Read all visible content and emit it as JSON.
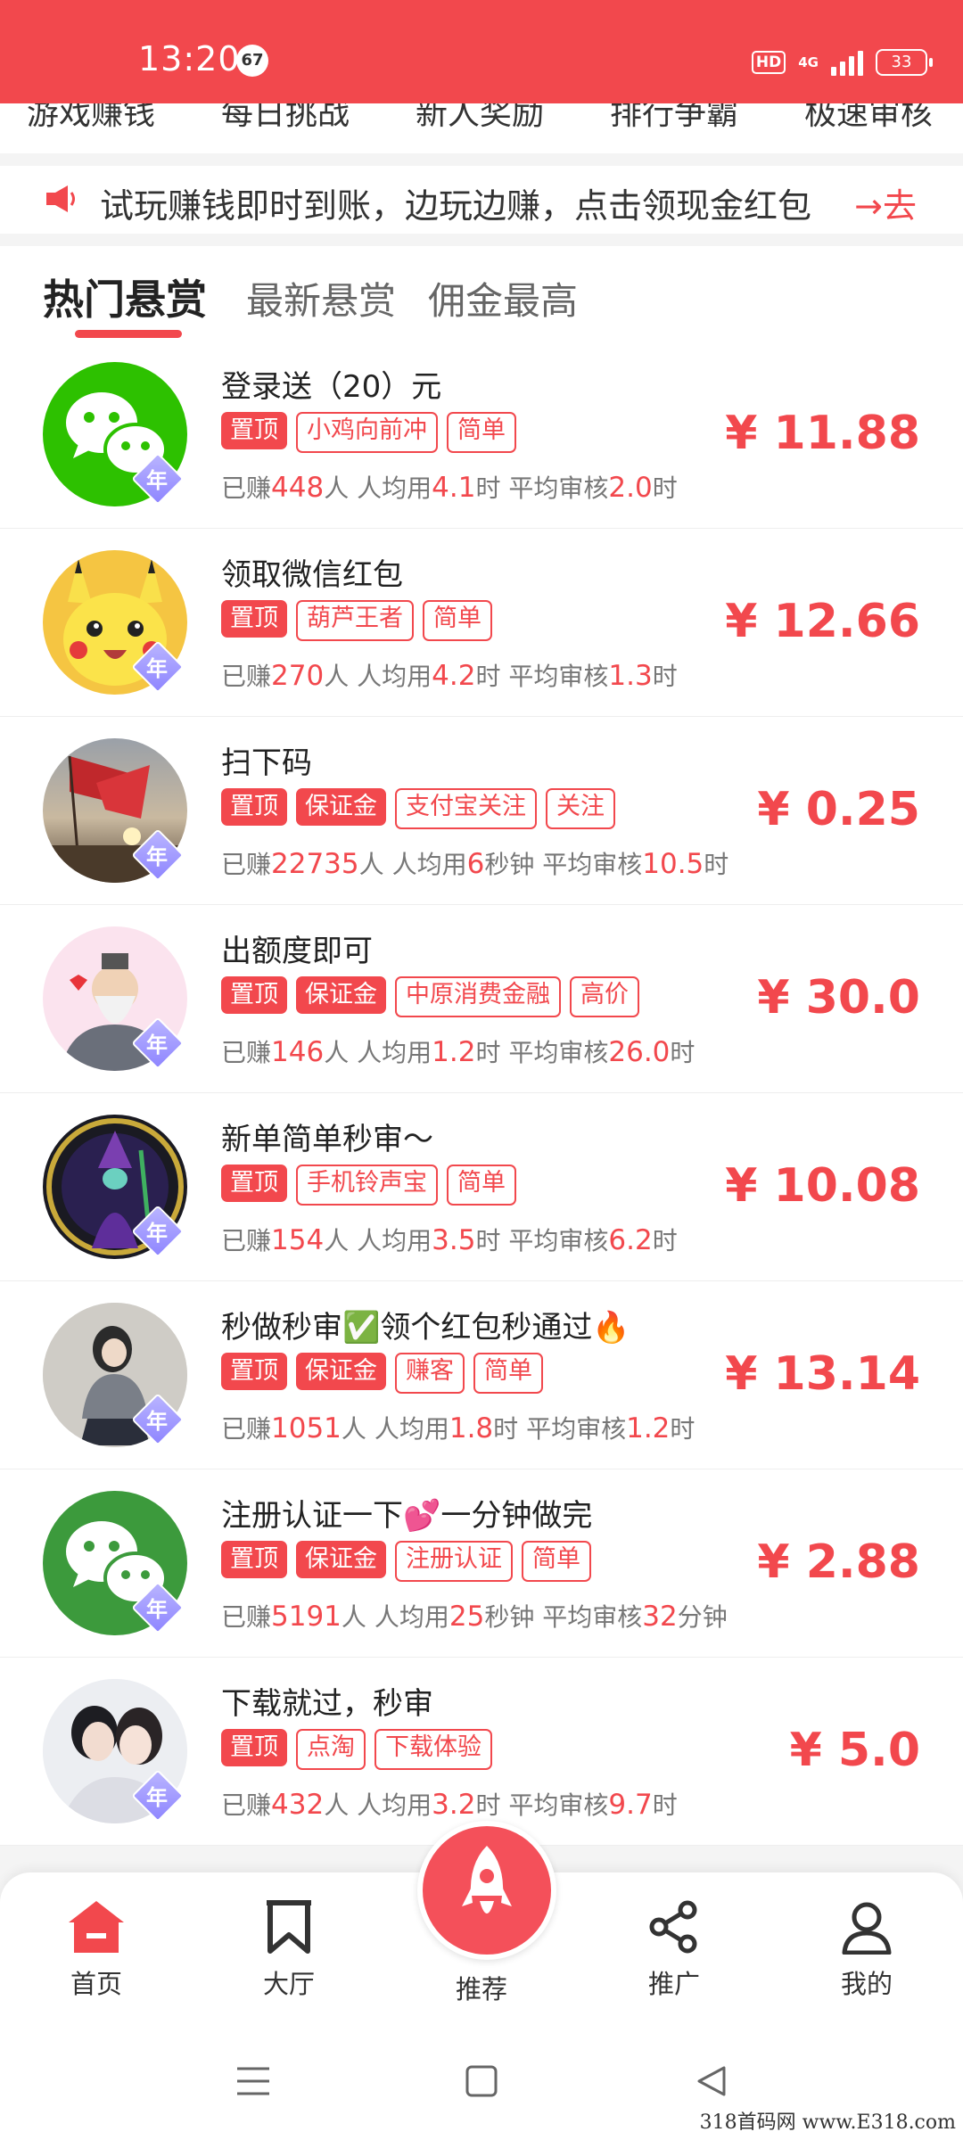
{
  "status_bar": {
    "time": "13:20",
    "notification_count": "67",
    "hd": "HD",
    "network": "4G",
    "battery": "33"
  },
  "categories": [
    "游戏赚钱",
    "每日挑战",
    "新人奖励",
    "排行争霸",
    "极速审核"
  ],
  "notice": {
    "text": "试玩赚钱即时到账，边玩边赚，点击领现金红包",
    "action": "→去"
  },
  "tabs": [
    "热门悬赏",
    "最新悬赏",
    "佣金最高"
  ],
  "badge_label": "年",
  "stat_labels": {
    "earned": "已赚",
    "people": "人",
    "avg": "人均用",
    "review": "平均审核"
  },
  "tasks": [
    {
      "title": "登录送（20）元",
      "tags": [
        "置顶",
        "小鸡向前冲",
        "简单"
      ],
      "earned": "448",
      "avg": "4.1",
      "avg_unit": "时",
      "review": "2.0",
      "review_unit": "时",
      "price": "¥ 11.88"
    },
    {
      "title": "领取微信红包",
      "tags": [
        "置顶",
        "葫芦王者",
        "简单"
      ],
      "earned": "270",
      "avg": "4.2",
      "avg_unit": "时",
      "review": "1.3",
      "review_unit": "时",
      "price": "¥ 12.66"
    },
    {
      "title": "扫下码",
      "tags": [
        "置顶",
        "保证金",
        "支付宝关注",
        "关注"
      ],
      "earned": "22735",
      "avg": "6",
      "avg_unit": "秒钟",
      "review": "10.5",
      "review_unit": "时",
      "price": "¥ 0.25"
    },
    {
      "title": "出额度即可",
      "tags": [
        "置顶",
        "保证金",
        "中原消费金融",
        "高价"
      ],
      "earned": "146",
      "avg": "1.2",
      "avg_unit": "时",
      "review": "26.0",
      "review_unit": "时",
      "price": "¥ 30.0"
    },
    {
      "title": "新单简单秒审～",
      "tags": [
        "置顶",
        "手机铃声宝",
        "简单"
      ],
      "earned": "154",
      "avg": "3.5",
      "avg_unit": "时",
      "review": "6.2",
      "review_unit": "时",
      "price": "¥ 10.08"
    },
    {
      "title": "秒做秒审✅领个红包秒通过🔥",
      "tags": [
        "置顶",
        "保证金",
        "赚客",
        "简单"
      ],
      "earned": "1051",
      "avg": "1.8",
      "avg_unit": "时",
      "review": "1.2",
      "review_unit": "时",
      "price": "¥ 13.14"
    },
    {
      "title": "注册认证一下💕一分钟做完",
      "tags": [
        "置顶",
        "保证金",
        "注册认证",
        "简单"
      ],
      "earned": "5191",
      "avg": "25",
      "avg_unit": "秒钟",
      "review": "32",
      "review_unit": "分钟",
      "price": "¥ 2.88"
    },
    {
      "title": "下载就过，秒审",
      "tags": [
        "置顶",
        "点淘",
        "下载体验"
      ],
      "earned": "432",
      "avg": "3.2",
      "avg_unit": "时",
      "review": "9.7",
      "review_unit": "时",
      "price": "¥ 5.0"
    }
  ],
  "bottom_nav": {
    "home": "首页",
    "hall": "大厅",
    "recommend": "推荐",
    "promote": "推广",
    "mine": "我的"
  },
  "colors": {
    "primary": "#f2484d",
    "tag_border": "#f2484d"
  },
  "watermark": "318首码网  www.E318.com"
}
